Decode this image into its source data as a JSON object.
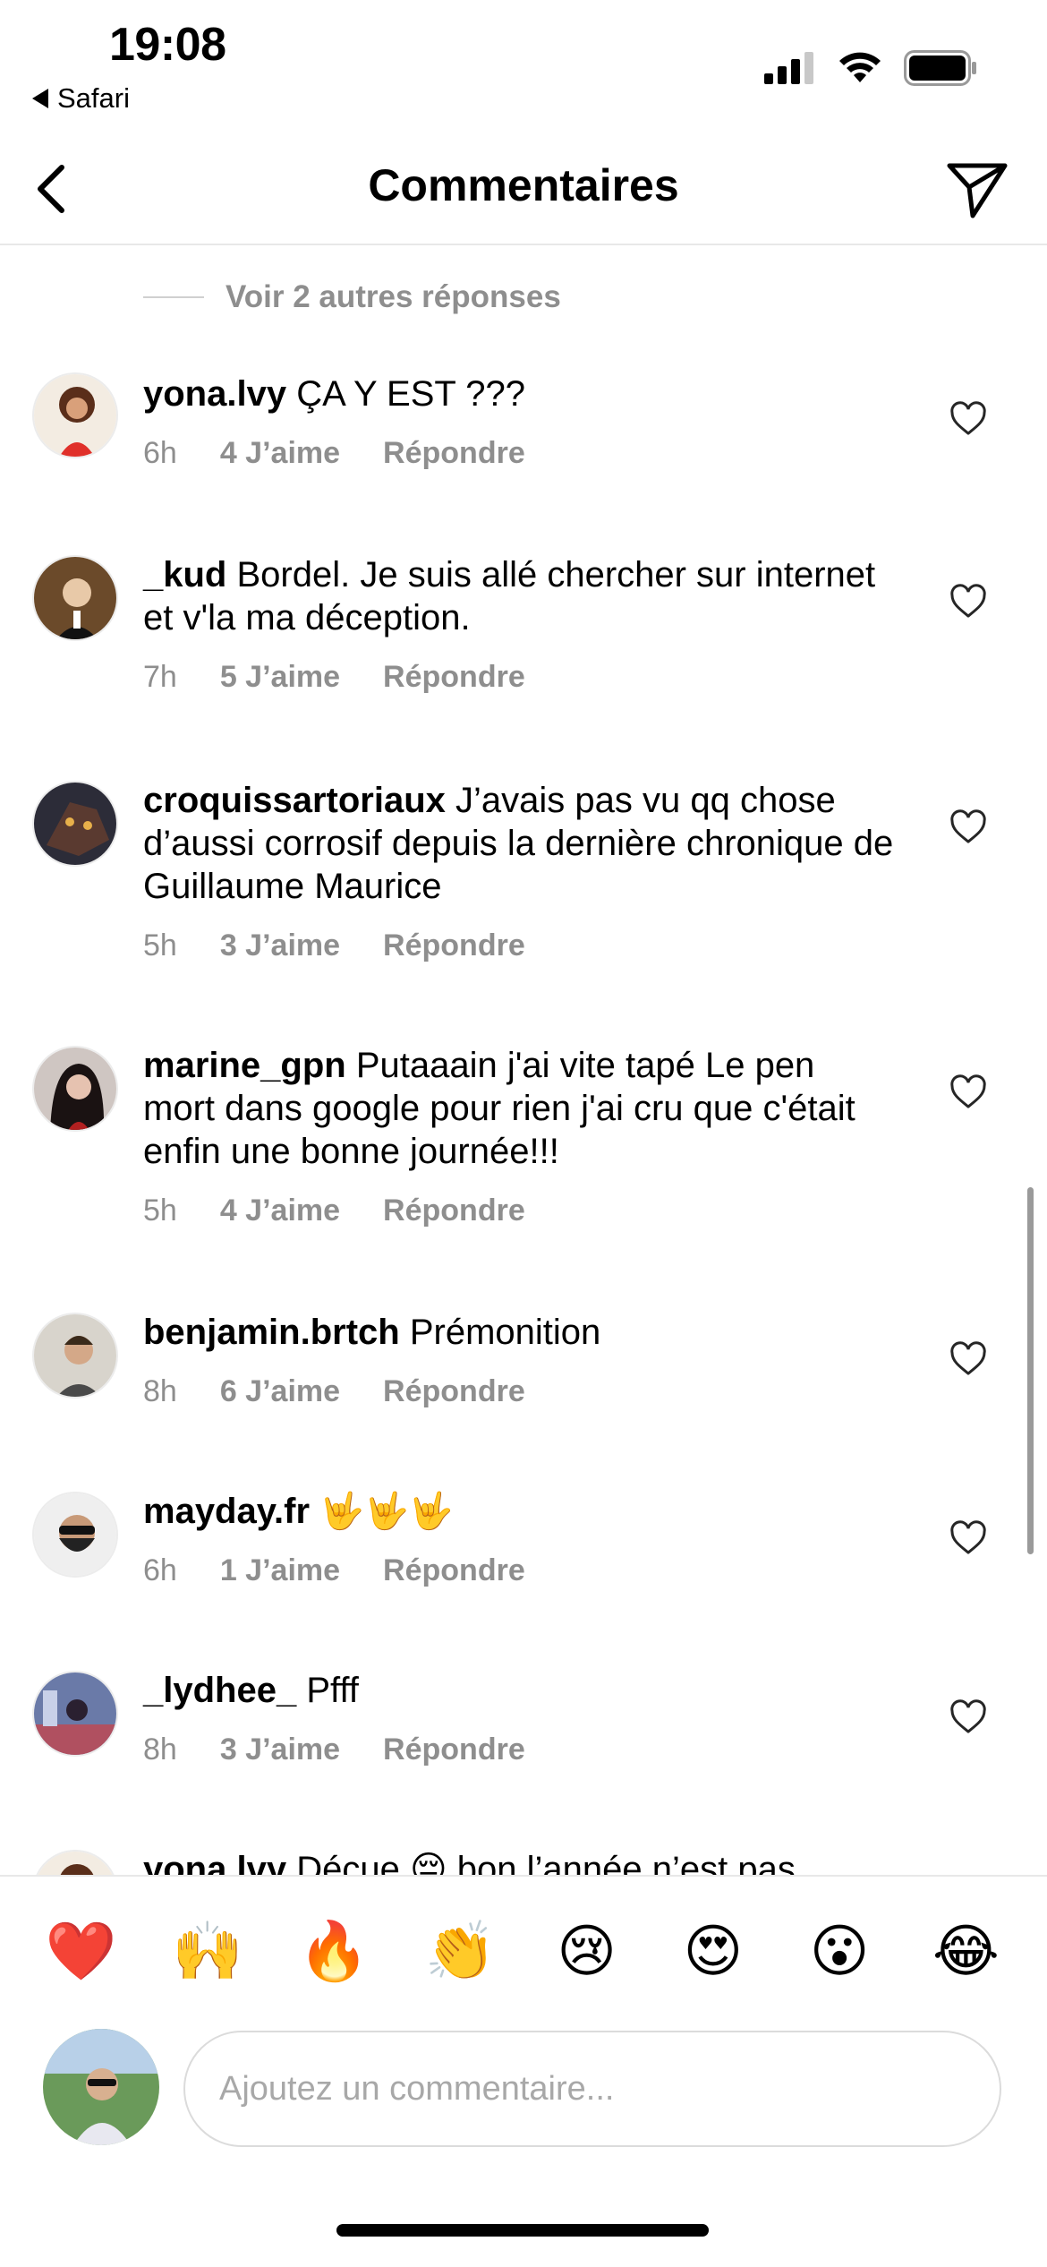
{
  "status_bar": {
    "time": "19:08",
    "back_app": "Safari"
  },
  "header": {
    "title": "Commentaires"
  },
  "more_replies": "Voir 2 autres réponses",
  "comments": [
    {
      "username": "yona.lvy",
      "text": "ÇA Y EST ???",
      "time": "6h",
      "likes": "4 J’aime",
      "reply": "Répondre"
    },
    {
      "username": "_kud",
      "text": "Bordel. Je suis allé chercher sur internet et v'la ma déception.",
      "time": "7h",
      "likes": "5 J’aime",
      "reply": "Répondre"
    },
    {
      "username": "croquissartoriaux",
      "text": "J’avais pas vu qq chose d’aussi corrosif depuis la dernière chronique de Guillaume Maurice",
      "time": "5h",
      "likes": "3 J’aime",
      "reply": "Répondre"
    },
    {
      "username": "marine_gpn",
      "text": "Putaaain j'ai vite tapé Le pen mort dans google pour rien j'ai cru que c'était enfin une bonne journée!!!",
      "time": "5h",
      "likes": "4 J’aime",
      "reply": "Répondre"
    },
    {
      "username": "benjamin.brtch",
      "text": "Prémonition",
      "time": "8h",
      "likes": "6 J’aime",
      "reply": "Répondre"
    },
    {
      "username": "mayday.fr",
      "text": "🤟🤟🤟",
      "time": "6h",
      "likes": "1 J’aime",
      "reply": "Répondre"
    },
    {
      "username": "_lydhee_",
      "text": "Pfff",
      "time": "8h",
      "likes": "3 J’aime",
      "reply": "Répondre"
    },
    {
      "username": "yona.lvy",
      "text": "Déçue 😔 bon l’année n’est pas",
      "time": "",
      "likes": "",
      "reply": ""
    }
  ],
  "emojis": [
    "❤️",
    "🙌",
    "🔥",
    "👏",
    "😢",
    "😍",
    "😮",
    "😂"
  ],
  "input": {
    "placeholder": "Ajoutez un commentaire..."
  },
  "colors": {
    "secondary_text": "#8e8e8e",
    "divider": "#e8e8e8"
  },
  "icons": [
    "back-chevron-icon",
    "send-paper-plane-icon",
    "heart-outline-icon",
    "signal-icon",
    "wifi-icon",
    "battery-icon"
  ]
}
